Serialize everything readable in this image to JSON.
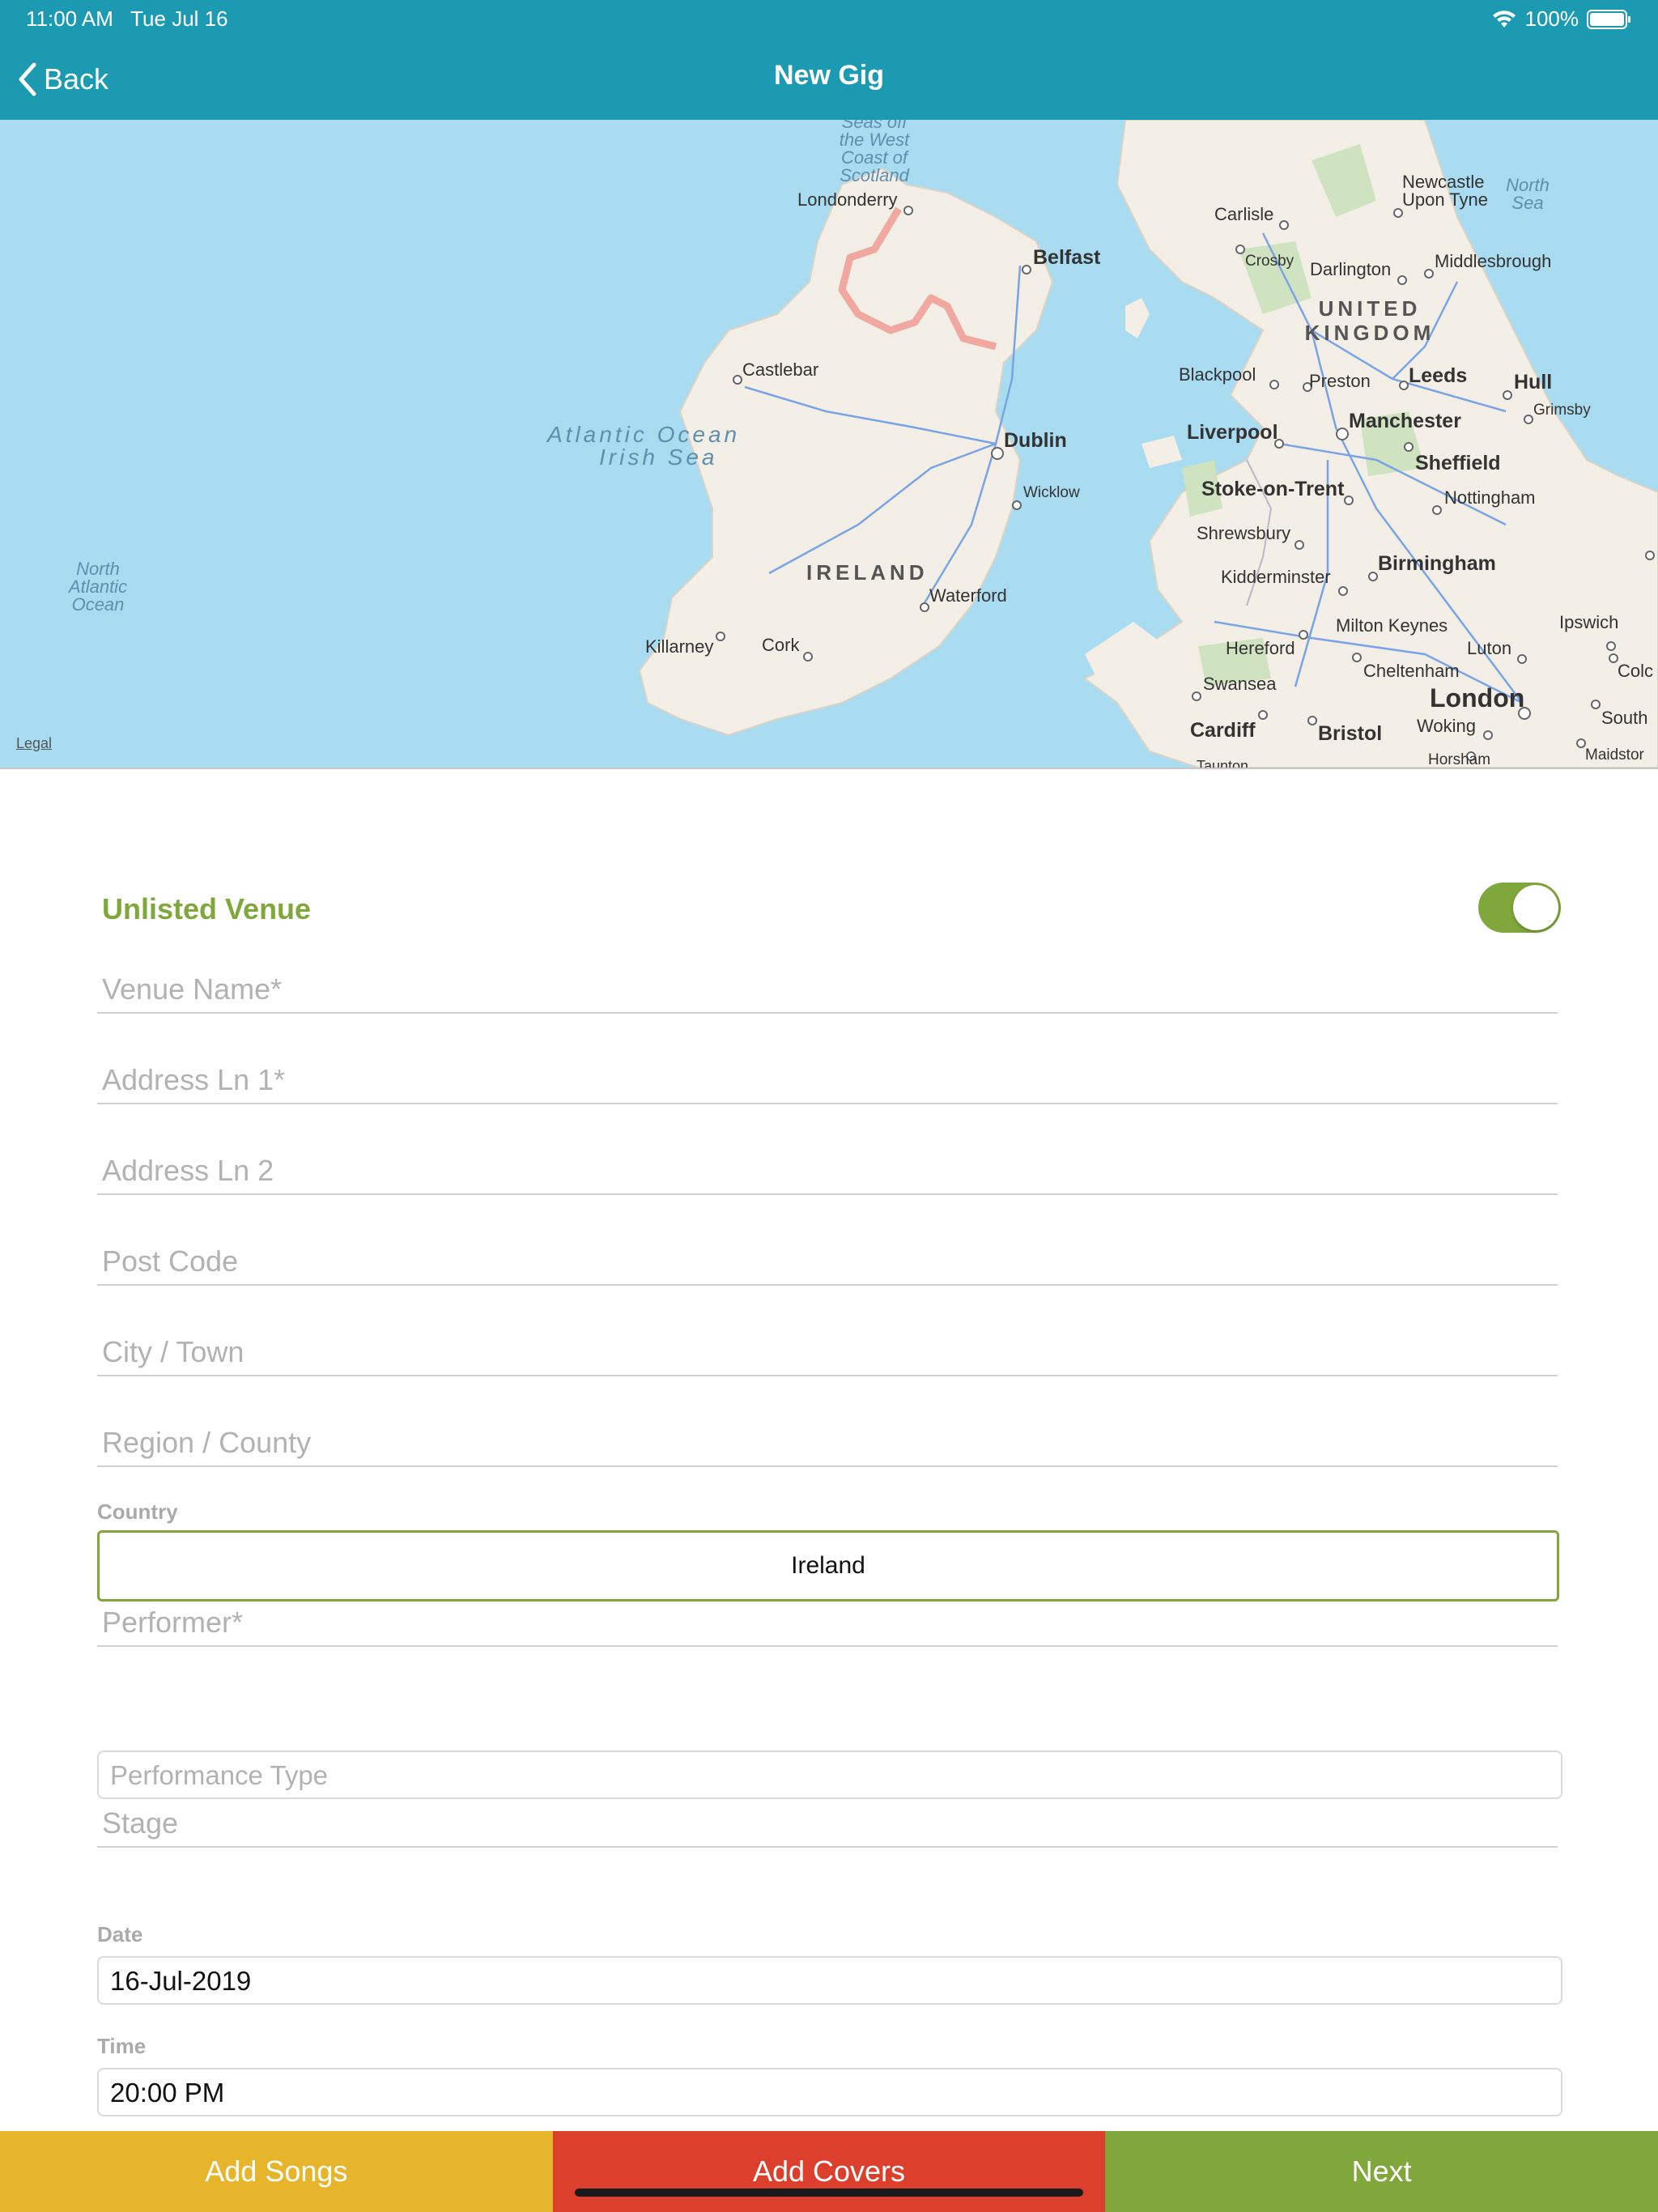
{
  "status_bar": {
    "time": "11:00 AM",
    "date": "Tue Jul 16",
    "battery": "100%"
  },
  "nav": {
    "back_label": "Back",
    "title": "New Gig"
  },
  "map": {
    "legal": "Legal",
    "labels": {
      "seas_west_scotland": "Seas off the West Coast of Scotland",
      "londonderry": "Londonderry",
      "belfast": "Belfast",
      "castlebar": "Castlebar",
      "atlantic_ocean": "Atlantic Ocean",
      "irish_sea": "Irish Sea",
      "dublin": "Dublin",
      "wicklow": "Wicklow",
      "ireland": "IRELAND",
      "waterford": "Waterford",
      "killarney": "Killarney",
      "cork": "Cork",
      "north_atlantic_ocean": "North Atlantic Ocean",
      "carlisle": "Carlisle",
      "newcastle": "Newcastle Upon Tyne",
      "north_sea": "North Sea",
      "crosby": "Crosby",
      "darlington": "Darlington",
      "middlesbrough": "Middlesbrough",
      "united_kingdom": "UNITED KINGDOM",
      "blackpool": "Blackpool",
      "preston": "Preston",
      "leeds": "Leeds",
      "hull": "Hull",
      "grimsby": "Grimsby",
      "liverpool": "Liverpool",
      "manchester": "Manchester",
      "sheffield": "Sheffield",
      "stoke": "Stoke-on-Trent",
      "nottingham": "Nottingham",
      "shrewsbury": "Shrewsbury",
      "birmingham": "Birmingham",
      "kidderminster": "Kidderminster",
      "ipswich": "Ipswich",
      "milton_keynes": "Milton Keynes",
      "hereford": "Hereford",
      "luton": "Luton",
      "colchester": "Colc",
      "cheltenham": "Cheltenham",
      "swansea": "Swansea",
      "london": "London",
      "cardiff": "Cardiff",
      "bristol": "Bristol",
      "woking": "Woking",
      "southend": "South",
      "horsham": "Horsham",
      "maidstone": "Maidstor",
      "taunton": "Taunton"
    }
  },
  "form": {
    "unlisted_venue_label": "Unlisted Venue",
    "unlisted_venue_on": true,
    "venue_name_placeholder": "Venue Name*",
    "address1_placeholder": "Address Ln 1*",
    "address2_placeholder": "Address Ln 2",
    "post_code_placeholder": "Post Code",
    "city_placeholder": "City / Town",
    "region_placeholder": "Region / County",
    "country_label": "Country",
    "country_value": "Ireland",
    "performer_placeholder": "Performer*",
    "performance_type_placeholder": "Performance Type",
    "stage_placeholder": "Stage",
    "date_label": "Date",
    "date_value": "16-Jul-2019",
    "time_label": "Time",
    "time_value": "20:00 PM"
  },
  "bottom_bar": {
    "add_songs": "Add Songs",
    "add_covers": "Add Covers",
    "next": "Next",
    "colors": {
      "add_songs": "#e6b52c",
      "add_covers": "#dc402c",
      "next": "#80a73c"
    }
  },
  "colors": {
    "accent": "#1c9ab1",
    "green": "#80a73c"
  }
}
